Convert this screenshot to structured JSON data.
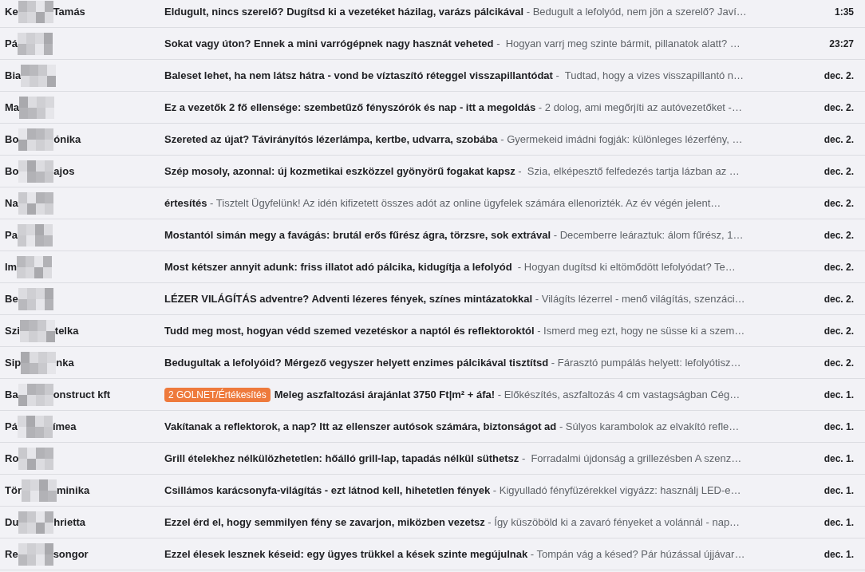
{
  "email_list": {
    "rows": [
      {
        "sender_start": "Ke",
        "sender_end": "Tamás",
        "unread": true,
        "subject": "Eldugult, nincs szerelő? Dugítsd ki a vezetéket házilag, varázs pálcikával",
        "snippet": " - Bedugult a lefolyód, nem jön a szerelő? Javí…",
        "time": "1:35"
      },
      {
        "sender_start": "Pá",
        "unread": true,
        "subject": "Sokat vagy úton? Ennek a mini varrógépnek nagy hasznát veheted",
        "snippet": " -  Hogyan varrj meg szinte bármit, pillanatok alatt? …",
        "time": "23:27"
      },
      {
        "sender_start": "Bia",
        "unread": true,
        "subject": "Baleset lehet, ha nem látsz hátra - vond be víztaszító réteggel visszapillantódat",
        "snippet": " -  Tudtad, hogy a vizes visszapillantó n…",
        "time": "dec. 2."
      },
      {
        "sender_start": "Ma",
        "unread": true,
        "subject": "Ez a vezetők 2 fő ellensége: szembetűző fényszórók és nap - itt a megoldás",
        "snippet": " - 2 dolog, ami megőrjíti az autóvezetőket -…",
        "time": "dec. 2."
      },
      {
        "sender_start": "Bo",
        "sender_end": "ónika",
        "unread": true,
        "subject": "Szereted az újat? Távirányítós lézerlámpa, kertbe, udvarra, szobába",
        "snippet": " - Gyermekeid imádni fogják: különleges lézerfény, …",
        "time": "dec. 2."
      },
      {
        "sender_start": "Bo",
        "sender_end": "ajos",
        "unread": true,
        "subject": "Szép mosoly, azonnal: új kozmetikai eszközzel gyönyörű fogakat kapsz",
        "snippet": " -  Szia, elképesztő felfedezés tartja lázban az …",
        "time": "dec. 2."
      },
      {
        "sender_start": "Na",
        "unread": true,
        "subject": "értesítés",
        "snippet": " - Tisztelt Ügyfelünk! Az idén kifizetett összes adót az online ügyfelek számára ellenorizték. Az év végén jelent…",
        "time": "dec. 2."
      },
      {
        "sender_start": "Pa",
        "unread": true,
        "subject": "Mostantól simán megy a favágás: brutál erős fűrész ágra, törzsre, sok extrával",
        "snippet": " - Decemberre leáraztuk: álom fűrész, 1…",
        "time": "dec. 2."
      },
      {
        "sender_start": "Im",
        "unread": true,
        "subject": "Most kétszer annyit adunk: friss illatot adó pálcika, kidugítja a lefolyód",
        "snippet": "  - Hogyan dugítsd ki eltömődött lefolyódat? Te…",
        "time": "dec. 2."
      },
      {
        "sender_start": "Be",
        "unread": true,
        "subject": "LÉZER VILÁGÍTÁS adventre? Adventi lézeres fények, színes mintázatokkal",
        "snippet": " - Világíts lézerrel - menő világítás, szenzáci…",
        "time": "dec. 2."
      },
      {
        "sender_start": "Szi",
        "sender_end": "telka",
        "unread": true,
        "subject": "Tudd meg most, hogyan védd szemed vezetéskor a naptól és reflektoroktól",
        "snippet": " - Ismerd meg ezt, hogy ne süsse ki a szem…",
        "time": "dec. 2."
      },
      {
        "sender_start": "Sip",
        "sender_end": "nka",
        "unread": true,
        "subject": "Bedugultak a lefolyóid? Mérgező vegyszer helyett enzimes pálcikával tisztítsd",
        "snippet": " - Fárasztó pumpálás helyett: lefolyótisz…",
        "time": "dec. 2."
      },
      {
        "sender_start": "Ba",
        "sender_end": "onstruct kft",
        "unread": true,
        "labels": [
          {
            "text": "2 GOLNET/Értékesítés",
            "color": "#ee7a3c"
          }
        ],
        "subject": "Meleg aszfaltozási árajánlat 3750 Ft|m² + áfa!",
        "snippet": " - Előkészítés, aszfaltozás 4 cm vastagságban Cég…",
        "time": "dec. 1."
      },
      {
        "sender_start": "Pá",
        "sender_end": "ímea",
        "unread": true,
        "subject": "Vakítanak a reflektorok, a nap? Itt az ellenszer autósok számára, biztonságot ad",
        "snippet": " - Súlyos karambolok az elvakító refle…",
        "time": "dec. 1."
      },
      {
        "sender_start": "Ro",
        "unread": true,
        "subject": "Grill ételekhez nélkülözhetetlen: hőálló grill-lap, tapadás nélkül süthetsz",
        "snippet": " -  Forradalmi újdonság a grillezésben A szenz…",
        "time": "dec. 1."
      },
      {
        "sender_start": "Tör",
        "sender_end": "minika",
        "unread": true,
        "subject": "Csillámos karácsonyfa-világítás - ezt látnod kell, hihetetlen fények",
        "snippet": " - Kigyulladó fényfüzérekkel vigyázz: használj LED-e…",
        "time": "dec. 1."
      },
      {
        "sender_start": "Du",
        "sender_end": "hrietta",
        "unread": true,
        "subject": "Ezzel érd el, hogy semmilyen fény se zavarjon, miközben vezetsz",
        "snippet": " - Így küszöböld ki a zavaró fényeket a volánnál - nap…",
        "time": "dec. 1."
      },
      {
        "sender_start": "Re",
        "sender_end": "songor",
        "unread": true,
        "subject": "Ezzel élesek lesznek késeid: egy ügyes trükkel a kések szinte megújulnak",
        "snippet": " - Tompán vág a késed? Pár húzással újjávar…",
        "time": "dec. 1."
      }
    ]
  }
}
